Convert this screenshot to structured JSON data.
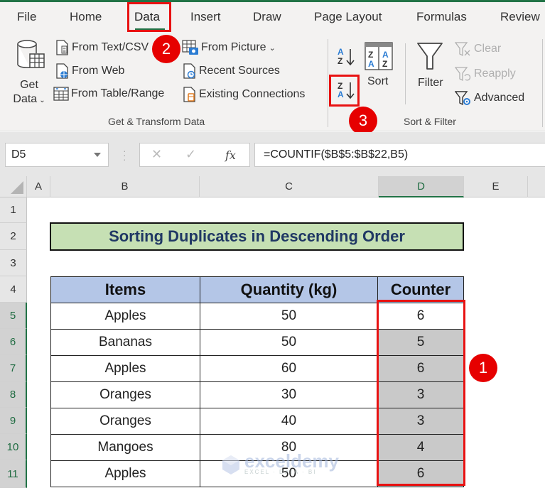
{
  "ribbon": {
    "tabs": [
      {
        "label": "File"
      },
      {
        "label": "Home"
      },
      {
        "label": "Data",
        "active": true
      },
      {
        "label": "Insert"
      },
      {
        "label": "Draw"
      },
      {
        "label": "Page Layout"
      },
      {
        "label": "Formulas"
      },
      {
        "label": "Review"
      }
    ],
    "get_transform": {
      "get_data_line1": "Get",
      "get_data_line2": "Data",
      "from_text_csv": "From Text/CSV",
      "from_web": "From Web",
      "from_table_range": "From Table/Range",
      "from_picture": "From Picture",
      "recent_sources": "Recent Sources",
      "existing_connections": "Existing Connections",
      "group_label": "Get & Transform Data"
    },
    "sort_filter": {
      "sort_az_glyph": "A Z",
      "sort_za_glyph": "Z A",
      "sort_label": "Sort",
      "filter_label": "Filter",
      "clear_label": "Clear",
      "reapply_label": "Reapply",
      "advanced_label": "Advanced",
      "group_label": "Sort & Filter"
    }
  },
  "formula_bar": {
    "name_box": "D5",
    "cancel_glyph": "✕",
    "enter_glyph": "✓",
    "fx_glyph": "fx",
    "formula": "=COUNTIF($B$5:$B$22,B5)"
  },
  "sheet": {
    "columns": [
      "A",
      "B",
      "C",
      "D",
      "E"
    ],
    "selected_column": "D",
    "rows": [
      "1",
      "2",
      "3",
      "4",
      "5",
      "6",
      "7",
      "8",
      "9",
      "10",
      "11"
    ],
    "title": "Sorting Duplicates in Descending Order",
    "headers": [
      "Items",
      "Quantity (kg)",
      "Counter"
    ],
    "data": [
      {
        "item": "Apples",
        "qty": "50",
        "counter": "6"
      },
      {
        "item": "Bananas",
        "qty": "50",
        "counter": "5"
      },
      {
        "item": "Apples",
        "qty": "60",
        "counter": "6"
      },
      {
        "item": "Oranges",
        "qty": "30",
        "counter": "3"
      },
      {
        "item": "Oranges",
        "qty": "40",
        "counter": "3"
      },
      {
        "item": "Mangoes",
        "qty": "80",
        "counter": "4"
      },
      {
        "item": "Apples",
        "qty": "50",
        "counter": "6"
      }
    ]
  },
  "annotations": {
    "step1": "1",
    "step2": "2",
    "step3": "3",
    "highlight_color": "#e81212"
  },
  "watermark": {
    "brand": "exceldemy",
    "tagline": "EXCEL · DATA · BI"
  }
}
